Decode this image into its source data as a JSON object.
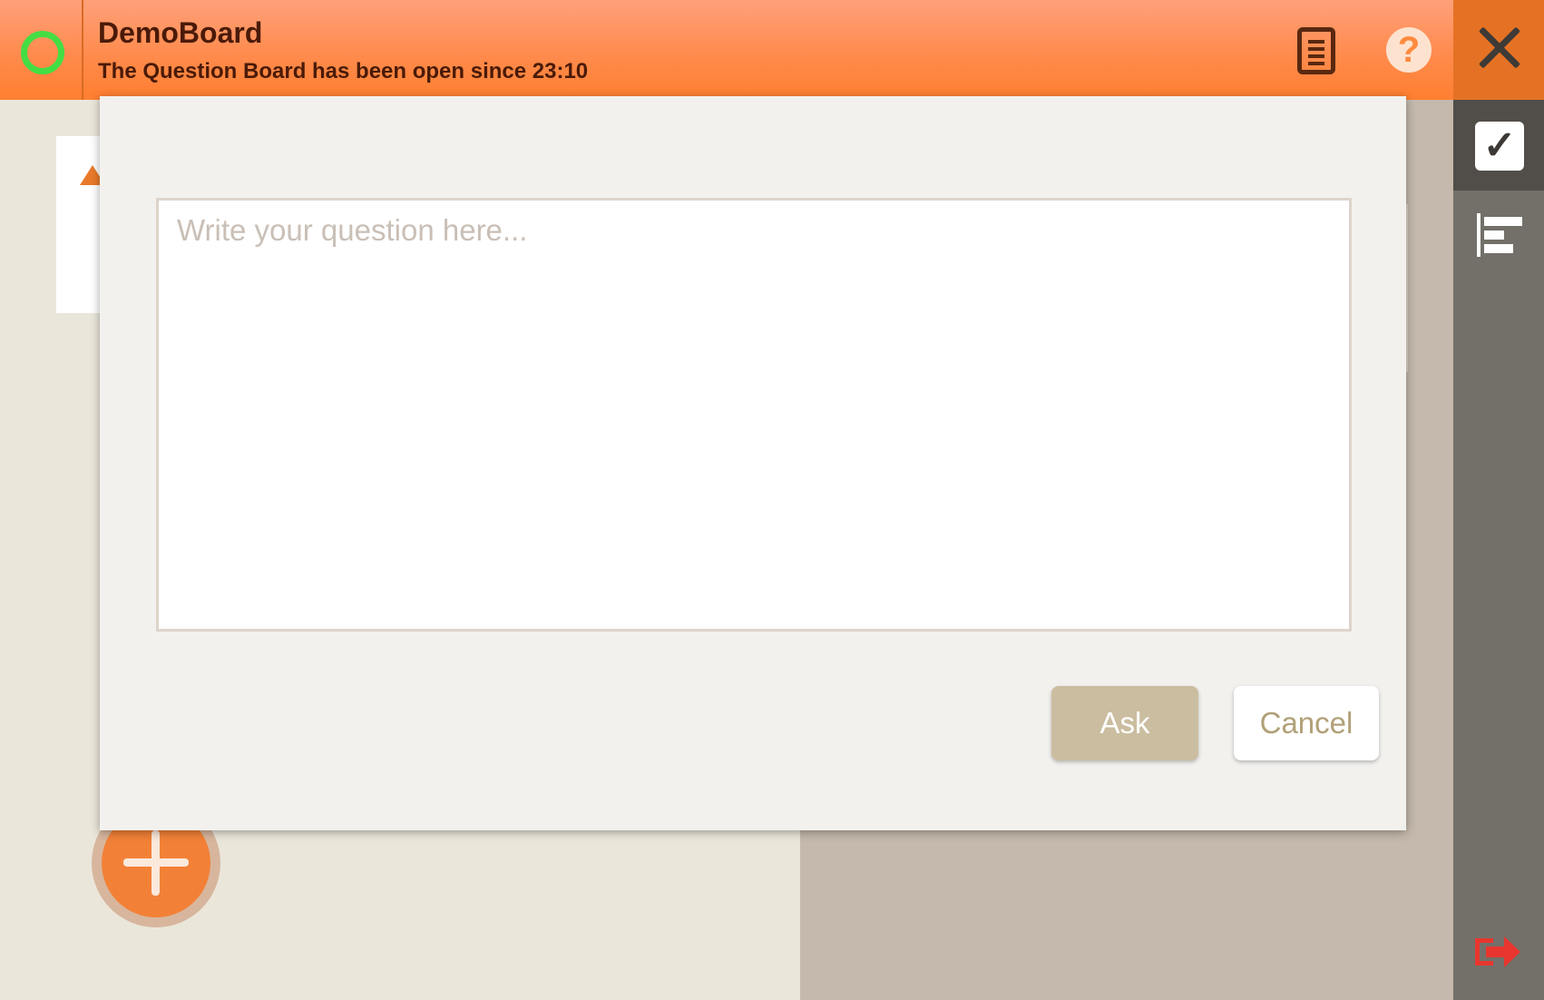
{
  "header": {
    "title": "DemoBoard",
    "subtitle": "The Question Board has been open since 23:10",
    "status_icon": "status-ring-icon",
    "status_color": "#44dd44",
    "list_icon": "document-list-icon",
    "help_icon": "help-icon",
    "help_glyph": "?"
  },
  "sidebar": {
    "close_icon": "close-icon",
    "check_glyph": "✓",
    "stats_icon": "stats-icon",
    "exit_icon": "exit-icon",
    "exit_color": "#e8362e"
  },
  "modal": {
    "question_placeholder": "Write your question here...",
    "question_value": "",
    "ask_label": "Ask",
    "cancel_label": "Cancel"
  },
  "fab": {
    "icon": "plus-icon",
    "color": "#f28137"
  },
  "colors": {
    "accent": "#ff8b4d",
    "sidebar": "#737069"
  }
}
